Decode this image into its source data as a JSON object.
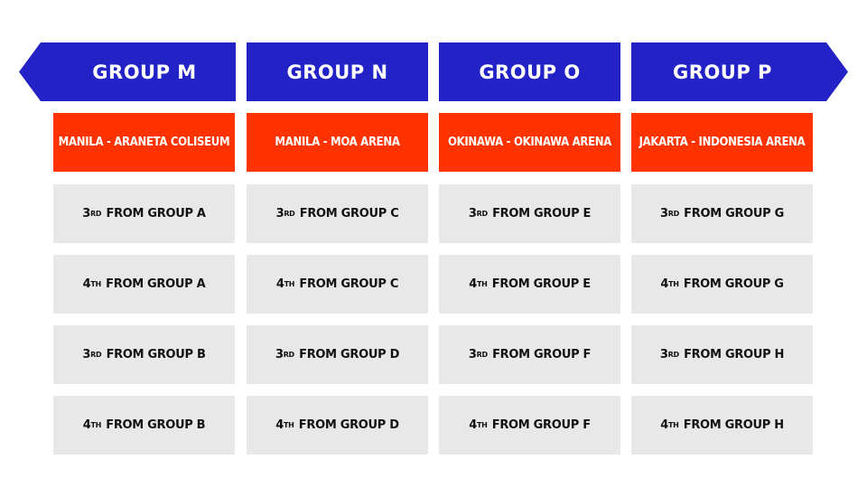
{
  "colors": {
    "header_bg": "#2222c6",
    "venue_bg": "#ff3300",
    "slot_bg": "#e8e8e8"
  },
  "groups": [
    {
      "title": "GROUP M",
      "venue": "MANILA - ARANETA COLISEUM",
      "slots": [
        {
          "rank": "3",
          "suffix": "RD",
          "text": "FROM GROUP A"
        },
        {
          "rank": "4",
          "suffix": "TH",
          "text": "FROM GROUP A"
        },
        {
          "rank": "3",
          "suffix": "RD",
          "text": "FROM GROUP B"
        },
        {
          "rank": "4",
          "suffix": "TH",
          "text": "FROM GROUP B"
        }
      ]
    },
    {
      "title": "GROUP N",
      "venue": "MANILA - MOA ARENA",
      "slots": [
        {
          "rank": "3",
          "suffix": "RD",
          "text": "FROM GROUP C"
        },
        {
          "rank": "4",
          "suffix": "TH",
          "text": "FROM GROUP C"
        },
        {
          "rank": "3",
          "suffix": "RD",
          "text": "FROM GROUP D"
        },
        {
          "rank": "4",
          "suffix": "TH",
          "text": "FROM GROUP D"
        }
      ]
    },
    {
      "title": "GROUP O",
      "venue": "OKINAWA - OKINAWA ARENA",
      "slots": [
        {
          "rank": "3",
          "suffix": "RD",
          "text": "FROM GROUP E"
        },
        {
          "rank": "4",
          "suffix": "TH",
          "text": "FROM GROUP E"
        },
        {
          "rank": "3",
          "suffix": "RD",
          "text": "FROM GROUP F"
        },
        {
          "rank": "4",
          "suffix": "TH",
          "text": "FROM GROUP F"
        }
      ]
    },
    {
      "title": "GROUP P",
      "venue": "JAKARTA - INDONESIA ARENA",
      "slots": [
        {
          "rank": "3",
          "suffix": "RD",
          "text": "FROM GROUP G"
        },
        {
          "rank": "4",
          "suffix": "TH",
          "text": "FROM GROUP G"
        },
        {
          "rank": "3",
          "suffix": "RD",
          "text": "FROM GROUP H"
        },
        {
          "rank": "4",
          "suffix": "TH",
          "text": "FROM GROUP H"
        }
      ]
    }
  ]
}
